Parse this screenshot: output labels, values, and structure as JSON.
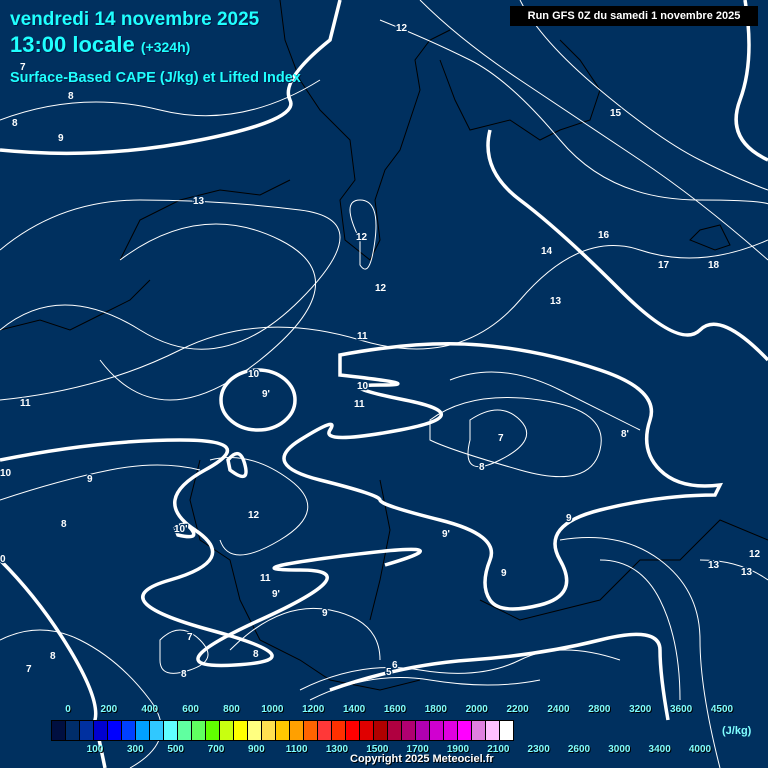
{
  "header": {
    "date": "vendredi 14 novembre 2025",
    "time": "13:00 locale",
    "step": "(+324h)",
    "parameter": "Surface-Based CAPE (J/kg) et Lifted Index",
    "run": "Run GFS 0Z du samedi 1 novembre 2025"
  },
  "contour_labels": [
    "12",
    "7",
    "8",
    "8",
    "9",
    "15",
    "13",
    "12",
    "16",
    "17",
    "18",
    "14",
    "12",
    "13",
    "11",
    "10",
    "9'",
    "10",
    "11",
    "11",
    "7",
    "8'",
    "8",
    "10",
    "9",
    "8",
    "10'",
    "12",
    "9",
    "9'",
    "9'",
    "11",
    "9",
    "9",
    "12",
    "13",
    "13",
    "0",
    "7",
    "8",
    "7",
    "8",
    "8",
    "6",
    "5"
  ],
  "legend": {
    "unit": "(J/kg)",
    "top_labels": [
      "0",
      "200",
      "400",
      "600",
      "800",
      "1000",
      "1200",
      "1400",
      "1600",
      "1800",
      "2000",
      "2200",
      "2400",
      "2800",
      "3200",
      "3600",
      "4500"
    ],
    "bottom_labels": [
      "100",
      "300",
      "500",
      "700",
      "900",
      "1100",
      "1300",
      "1500",
      "1700",
      "1900",
      "2100",
      "2300",
      "2600",
      "3000",
      "3400",
      "4000"
    ],
    "colors": [
      "#000f40",
      "#002d6a",
      "#0030a0",
      "#0000d0",
      "#0000ff",
      "#0040ff",
      "#00a0ff",
      "#30c8ff",
      "#60ffff",
      "#60ffa0",
      "#60ff60",
      "#60ff00",
      "#c8ff10",
      "#ffff00",
      "#ffff80",
      "#ffe050",
      "#ffc800",
      "#ffa000",
      "#ff6400",
      "#ff3838",
      "#ff3000",
      "#ff0000",
      "#e00000",
      "#b00000",
      "#b00040",
      "#b00070",
      "#b000b0",
      "#d000d0",
      "#e000e0",
      "#ff00ff",
      "#e080e0",
      "#ffc0ff",
      "#ffffff"
    ]
  },
  "copyright": "Copyright 2025 Meteociel.fr"
}
